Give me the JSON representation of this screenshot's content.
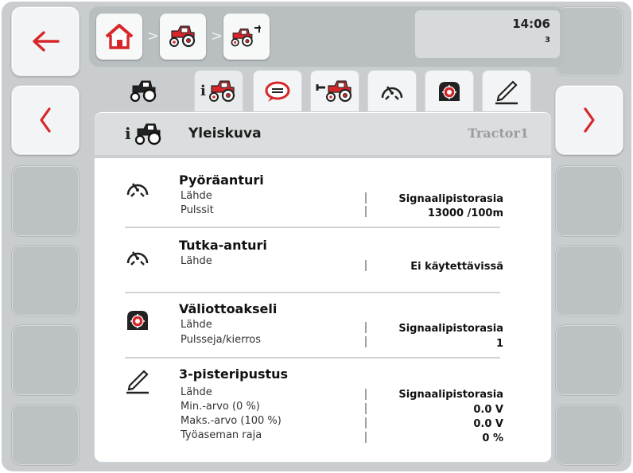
{
  "header": {
    "clock": "14:06",
    "clock_sub": "3",
    "crumbs": [
      "home-icon",
      "tractor-icon",
      "tractor-implement-icon"
    ],
    "crumb_sep": ">"
  },
  "nav": {
    "back_icon": "arrow-left-icon",
    "prev_icon": "chevron-left-icon",
    "next_icon": "chevron-right-icon"
  },
  "tabs": [
    {
      "icon": "tractor-icon",
      "state": "plain"
    },
    {
      "icon": "tractor-info-icon",
      "state": "active"
    },
    {
      "icon": "speech-bubble-icon",
      "state": "boxed"
    },
    {
      "icon": "tractor-hitch-icon",
      "state": "boxed"
    },
    {
      "icon": "speed-sensor-icon",
      "state": "boxed"
    },
    {
      "icon": "pto-icon",
      "state": "boxed"
    },
    {
      "icon": "three-point-hitch-icon",
      "state": "boxed"
    }
  ],
  "title": {
    "prefix": "i",
    "text": "Yleiskuva",
    "tractor_name": "Tractor1"
  },
  "sections": {
    "wheel": {
      "title": "Pyöräanturi",
      "rows": [
        {
          "label": "Lähde",
          "value": "Signaalipistorasia"
        },
        {
          "label": "Pulssit",
          "value": "13000 /100m"
        }
      ]
    },
    "radar": {
      "title": "Tutka-anturi",
      "rows": [
        {
          "label": "Lähde",
          "value": "Ei käytettävissä"
        }
      ]
    },
    "pto": {
      "title": "Väliottoakseli",
      "rows": [
        {
          "label": "Lähde",
          "value": "Signaalipistorasia"
        },
        {
          "label": "Pulsseja/kierros",
          "value": "1"
        }
      ]
    },
    "hitch": {
      "title": "3-pisteripustus",
      "rows": [
        {
          "label": "Lähde",
          "value": "Signaalipistorasia"
        },
        {
          "label": "Min.-arvo (0 %)",
          "value": "0.0 V"
        },
        {
          "label": "Maks.-arvo (100 %)",
          "value": "0.0 V"
        },
        {
          "label": "Työaseman raja",
          "value": "0 %"
        }
      ]
    }
  },
  "colors": {
    "accent_red": "#d7262a",
    "frame": "#c9cdcf",
    "panel": "#ffffff"
  }
}
